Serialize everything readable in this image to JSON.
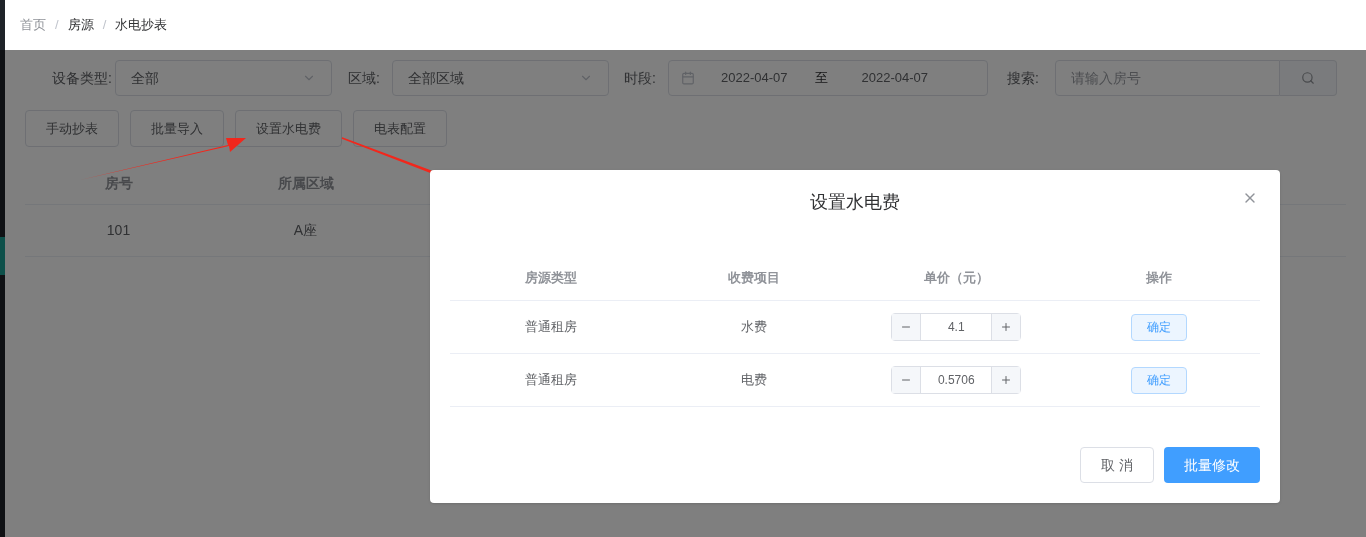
{
  "breadcrumb": [
    "首页",
    "房源",
    "水电抄表"
  ],
  "breadcrumb_separator": "/",
  "filters": {
    "device_type": {
      "label": "设备类型:",
      "value": "全部"
    },
    "area": {
      "label": "区域:",
      "value": "全部区域"
    },
    "period": {
      "label": "时段:",
      "start": "2022-04-07",
      "separator": "至",
      "end": "2022-04-07"
    },
    "search": {
      "label": "搜索:",
      "placeholder": "请输入房号"
    }
  },
  "actions": [
    "手动抄表",
    "批量导入",
    "设置水电费",
    "电表配置"
  ],
  "table": {
    "columns": [
      "房号",
      "所属区域"
    ],
    "rows": [
      [
        "101",
        "A座"
      ]
    ]
  },
  "dialog": {
    "title": "设置水电费",
    "columns": [
      "房源类型",
      "收费项目",
      "单价（元）",
      "操作"
    ],
    "rows": [
      {
        "room_type": "普通租房",
        "fee_item": "水费",
        "price": "4.1",
        "action": "确定"
      },
      {
        "room_type": "普通租房",
        "fee_item": "电费",
        "price": "0.5706",
        "action": "确定"
      }
    ],
    "buttons": [
      {
        "label": "取 消",
        "kind": "default"
      },
      {
        "label": "批量修改",
        "kind": "primary"
      }
    ]
  }
}
